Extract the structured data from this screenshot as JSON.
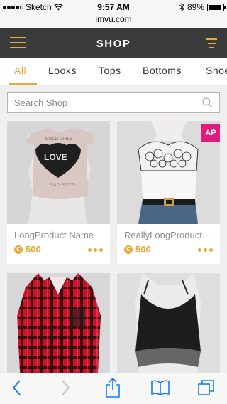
{
  "status_bar": {
    "carrier": "Sketch",
    "time": "9:57 AM",
    "battery": "89%",
    "battery_level": 0.89
  },
  "browser": {
    "url": "imvu.com"
  },
  "header": {
    "title": "SHOP"
  },
  "tabs": [
    {
      "label": "All",
      "active": true
    },
    {
      "label": "Looks",
      "active": false
    },
    {
      "label": "Tops",
      "active": false
    },
    {
      "label": "Bottoms",
      "active": false
    },
    {
      "label": "Shoe",
      "active": false
    }
  ],
  "search": {
    "placeholder": "Search Shop"
  },
  "products": [
    {
      "name": "LongProduct Name",
      "price": "500",
      "badge": "",
      "image": "love-tshirt"
    },
    {
      "name": "ReallyLongProduct...",
      "price": "500",
      "badge": "AP",
      "image": "lace-top-with-jeans"
    },
    {
      "name": "",
      "price": "",
      "badge": "",
      "image": "red-plaid-shirt"
    },
    {
      "name": "",
      "price": "",
      "badge": "",
      "image": "black-crop-top"
    }
  ],
  "coin_symbol": "C",
  "colors": {
    "accent": "#e7a93b",
    "header_bg": "#3b3b3b",
    "badge": "#e01b7c"
  },
  "toolbar": {
    "icons": [
      "back-icon",
      "forward-icon",
      "share-icon",
      "bookmarks-icon",
      "tabs-icon"
    ]
  }
}
